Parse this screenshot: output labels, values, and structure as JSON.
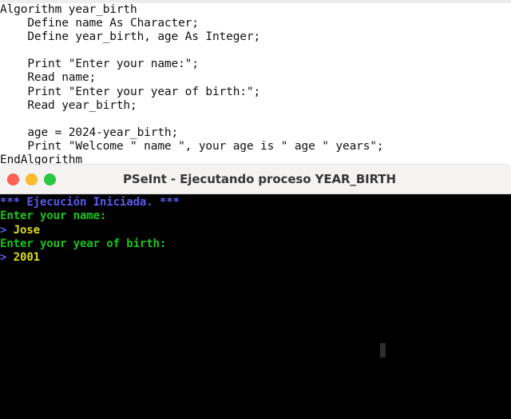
{
  "editor": {
    "language": "PSeInt pseudocode",
    "code_lines": [
      "Algorithm year_birth",
      "    Define name As Character;",
      "    Define year_birth, age As Integer;",
      "",
      "    Print \"Enter your name:\";",
      "    Read name;",
      "    Print \"Enter your year of birth:\";",
      "    Read year_birth;",
      "",
      "    age = 2024-year_birth;",
      "    Print \"Welcome \" name \", your age is \" age \" years\";",
      "EndAlgorithm"
    ]
  },
  "window": {
    "title": "PSeInt - Ejecutando proceso YEAR_BIRTH",
    "traffic_lights": [
      {
        "name": "close-button",
        "color": "#ff5f57"
      },
      {
        "name": "minimize-button",
        "color": "#ffbd2e"
      },
      {
        "name": "maximize-button",
        "color": "#28c840"
      }
    ]
  },
  "console": {
    "background": "#000000",
    "colors": {
      "system": "#5a5aee",
      "prompt": "#18c418",
      "caret": "#5a5aee",
      "input": "#dcdc16"
    },
    "lines": [
      {
        "type": "system",
        "text": "*** Ejecución Iniciada. ***"
      },
      {
        "type": "prompt",
        "text": "Enter your name:"
      },
      {
        "type": "input",
        "caret": "> ",
        "text": "Jose"
      },
      {
        "type": "prompt",
        "text": "Enter your year of birth:"
      },
      {
        "type": "input",
        "caret": "> ",
        "text": "2001"
      }
    ],
    "cursor_visible": true
  }
}
